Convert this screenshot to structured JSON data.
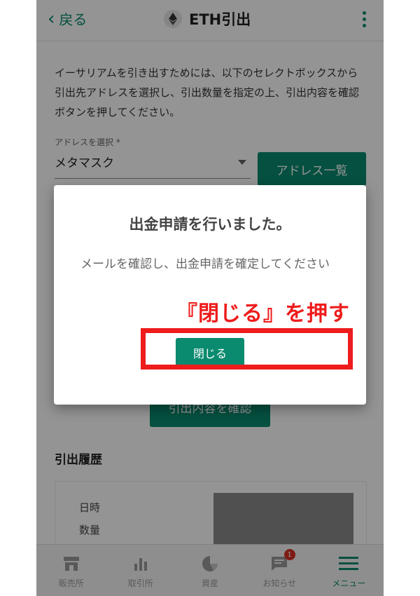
{
  "header": {
    "back_label": "戻る",
    "title": "ETH引出",
    "accent_color": "#0a8a6e"
  },
  "content": {
    "description": "イーサリアムを引き出すためには、以下のセレクトボックスから引出先アドレスを選択し、引出数量を指定の上、引出内容を確認ボタンを押してください。",
    "address_label": "アドレスを選択 *",
    "address_value": "メタマスク",
    "address_list_button": "アドレス一覧",
    "confirm_button": "引出内容を確認",
    "history_title": "引出履歴",
    "history_fields": [
      "日時",
      "数量"
    ]
  },
  "dialog": {
    "title": "出金申請を行いました。",
    "body": "メールを確認し、出金申請を確定してください",
    "close_button": "閉じる"
  },
  "annotation": {
    "text": "『閉じる』を押す",
    "color": "#ee1c1c"
  },
  "bottom_nav": {
    "items": [
      {
        "label": "販売所",
        "icon": "store-icon"
      },
      {
        "label": "取引所",
        "icon": "bar-chart-icon"
      },
      {
        "label": "資産",
        "icon": "pie-chart-icon"
      },
      {
        "label": "お知らせ",
        "icon": "message-icon",
        "badge": "1"
      },
      {
        "label": "メニュー",
        "icon": "menu-icon",
        "active": true
      }
    ]
  }
}
